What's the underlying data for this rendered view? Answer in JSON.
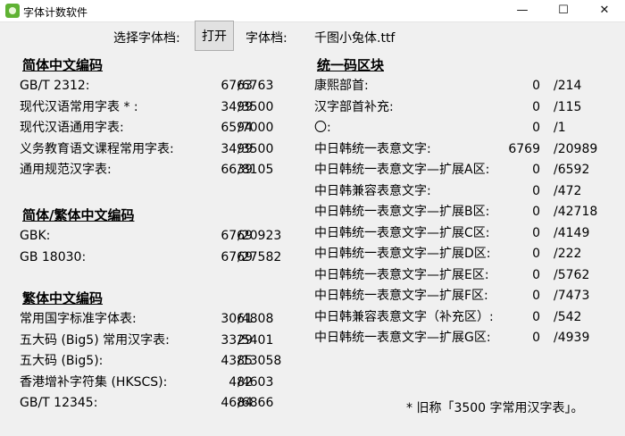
{
  "window": {
    "title": "字体计数软件",
    "minimize": "—",
    "maximize": "☐",
    "close": "✕",
    "icon": "app-icon"
  },
  "toolbar": {
    "choose_label": "选择字体档:",
    "open_button": "打开",
    "font_label": "字体档:",
    "font_name": "千图小兔体.ttf"
  },
  "left_sections": [
    {
      "heading": "简体中文编码",
      "rows": [
        {
          "label": "GB/T 2312:",
          "count": "6763",
          "total": "/6763"
        },
        {
          "label": "现代汉语常用字表 * :",
          "count": "3499",
          "total": "/3500"
        },
        {
          "label": "现代汉语通用字表:",
          "count": "6594",
          "total": "/7000"
        },
        {
          "label": "义务教育语文课程常用字表:",
          "count": "3499",
          "total": "/3500"
        },
        {
          "label": "通用规范汉字表:",
          "count": "6639",
          "total": "/8105"
        }
      ]
    },
    {
      "heading": "简体/繁体中文编码",
      "rows": [
        {
          "label": "GBK:",
          "count": "6769",
          "total": "/20923"
        },
        {
          "label": "GB 18030:",
          "count": "6769",
          "total": "/27582"
        }
      ]
    },
    {
      "heading": "繁体中文编码",
      "rows": [
        {
          "label": "常用国字标准字体表:",
          "count": "3061",
          "total": "/4808"
        },
        {
          "label": "五大码 (Big5) 常用汉字表:",
          "count": "3329",
          "total": "/5401"
        },
        {
          "label": "五大码 (Big5):",
          "count": "4385",
          "total": "/13058"
        },
        {
          "label": "香港增补字符集 (HKSCS):",
          "count": "482",
          "total": "/4603"
        },
        {
          "label": "GB/T 12345:",
          "count": "4684",
          "total": "/6866"
        }
      ]
    }
  ],
  "right_section": {
    "heading": "统一码区块",
    "rows": [
      {
        "label": "康熙部首:",
        "count": "0",
        "total": "/214"
      },
      {
        "label": "汉字部首补充:",
        "count": "0",
        "total": "/115"
      },
      {
        "label": "〇:",
        "count": "0",
        "total": "/1"
      },
      {
        "label": "中日韩统一表意文字:",
        "count": "6769",
        "total": "/20989"
      },
      {
        "label": "中日韩统一表意文字—扩展A区:",
        "count": "0",
        "total": "/6592"
      },
      {
        "label": "中日韩兼容表意文字:",
        "count": "0",
        "total": "/472"
      },
      {
        "label": "中日韩统一表意文字—扩展B区:",
        "count": "0",
        "total": "/42718"
      },
      {
        "label": "中日韩统一表意文字—扩展C区:",
        "count": "0",
        "total": "/4149"
      },
      {
        "label": "中日韩统一表意文字—扩展D区:",
        "count": "0",
        "total": "/222"
      },
      {
        "label": "中日韩统一表意文字—扩展E区:",
        "count": "0",
        "total": "/5762"
      },
      {
        "label": "中日韩统一表意文字—扩展F区:",
        "count": "0",
        "total": "/7473"
      },
      {
        "label": "中日韩兼容表意文字（补充区）:",
        "count": "0",
        "total": "/542"
      },
      {
        "label": "中日韩统一表意文字—扩展G区:",
        "count": "0",
        "total": "/4939"
      }
    ]
  },
  "footnote": "* 旧称「3500 字常用汉字表」。"
}
